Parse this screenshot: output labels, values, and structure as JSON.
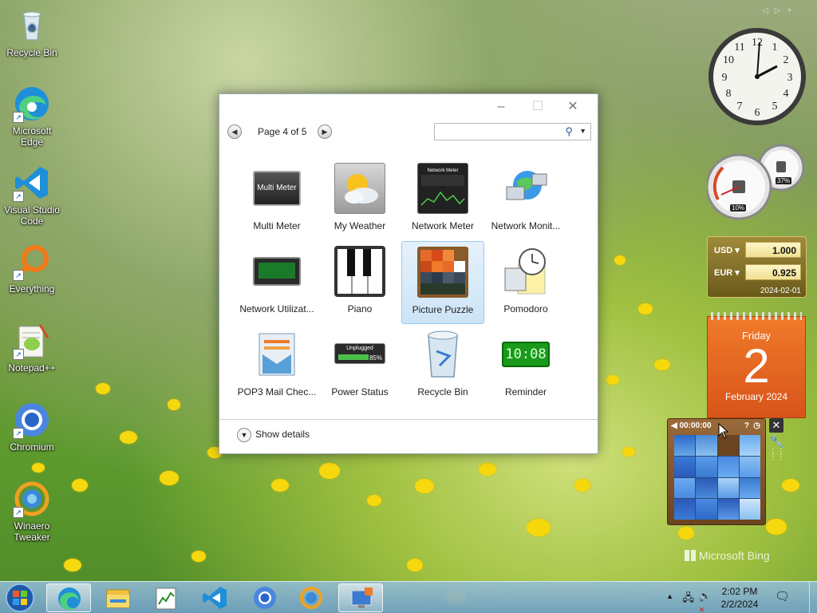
{
  "desktop_icons": [
    {
      "label": "Recycle Bin",
      "icon": "recycle-bin-icon"
    },
    {
      "label": "Microsoft Edge",
      "icon": "edge-icon"
    },
    {
      "label": "Visual Studio Code",
      "icon": "vscode-icon"
    },
    {
      "label": "Everything",
      "icon": "everything-icon"
    },
    {
      "label": "Notepad++",
      "icon": "notepadpp-icon"
    },
    {
      "label": "Chromium",
      "icon": "chromium-icon"
    },
    {
      "label": "Winaero Tweaker",
      "icon": "winaero-tweaker-icon"
    }
  ],
  "dialog": {
    "page_label": "Page 4 of 5",
    "search_placeholder": "",
    "show_details": "Show details",
    "gadgets": [
      {
        "label": "Multi Meter",
        "icon": "multi-meter-icon",
        "selected": false
      },
      {
        "label": "My Weather",
        "icon": "weather-icon",
        "selected": false
      },
      {
        "label": "Network Meter",
        "icon": "network-meter-icon",
        "selected": false
      },
      {
        "label": "Network Monit...",
        "icon": "network-monitor-icon",
        "selected": false
      },
      {
        "label": "Network Utilizat...",
        "icon": "network-utilization-icon",
        "selected": false
      },
      {
        "label": "Piano",
        "icon": "piano-icon",
        "selected": false
      },
      {
        "label": "Picture Puzzle",
        "icon": "picture-puzzle-icon",
        "selected": true
      },
      {
        "label": "Pomodoro",
        "icon": "pomodoro-icon",
        "selected": false
      },
      {
        "label": "POP3 Mail Chec...",
        "icon": "mail-icon",
        "selected": false
      },
      {
        "label": "Power Status",
        "icon": "battery-icon",
        "selected": false
      },
      {
        "label": "Recycle Bin",
        "icon": "recycle-bin-icon",
        "selected": false
      },
      {
        "label": "Reminder",
        "icon": "reminder-icon",
        "selected": false
      }
    ],
    "multi_meter_text": "Multi Meter",
    "power_text": "Unplugged",
    "power_pct": "85%",
    "reminder_digits": "10:08"
  },
  "gadgets_side": {
    "clock": {
      "hour": 2,
      "minute": 2
    },
    "meters": {
      "cpu": "10%",
      "ram": "37%"
    },
    "currency": {
      "rows": [
        {
          "code": "USD",
          "value": "1.000"
        },
        {
          "code": "EUR",
          "value": "0.925"
        }
      ],
      "date": "2024-02-01"
    },
    "calendar": {
      "weekday": "Friday",
      "day": "2",
      "month_year": "February 2024"
    },
    "puzzle": {
      "timer": "00:00:00"
    }
  },
  "watermark": "Microsoft Bing",
  "taskbar": {
    "apps": [
      "start-orb",
      "edge-icon",
      "file-explorer-icon",
      "notepad-chart-icon",
      "vscode-icon",
      "chromium-icon",
      "winaero-icon",
      "gadgets-icon"
    ],
    "time": "2:02 PM",
    "date": "2/2/2024"
  }
}
